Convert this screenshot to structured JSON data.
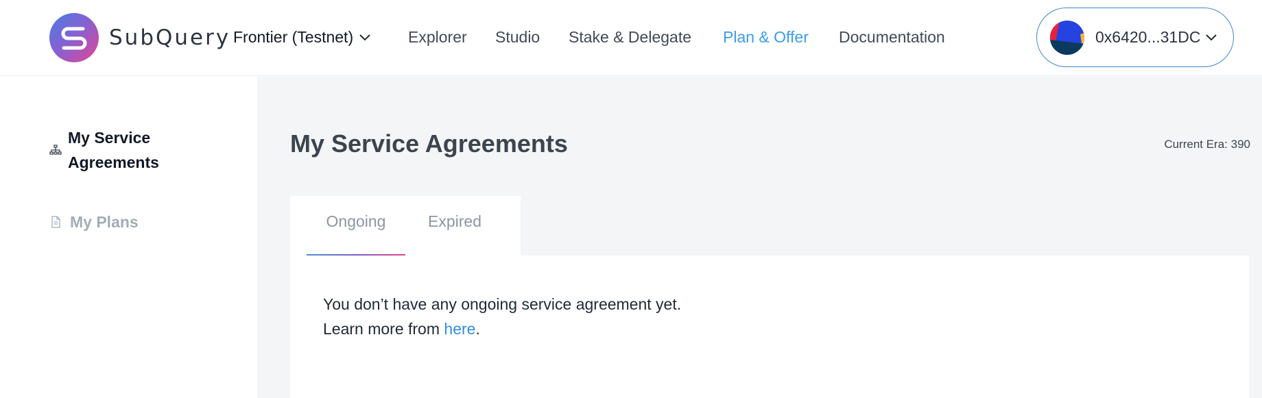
{
  "header": {
    "brand": "SubQuery",
    "network": "Frontier (Testnet)",
    "nav": {
      "explorer": "Explorer",
      "studio": "Studio",
      "stake": "Stake & Delegate",
      "plan": "Plan & Offer",
      "docs": "Documentation"
    },
    "wallet": {
      "address": "0x6420...31DC"
    }
  },
  "sidebar": {
    "items": [
      {
        "label": "My Service Agreements",
        "icon": "sitemap-icon",
        "active": true
      },
      {
        "label": "My Plans",
        "icon": "document-icon",
        "active": false
      }
    ]
  },
  "main": {
    "title": "My Service Agreements",
    "era_label": "Current Era: 390",
    "tabs": [
      {
        "label": "Ongoing",
        "active": true
      },
      {
        "label": "Expired",
        "active": false
      }
    ],
    "empty": {
      "line1": "You don’t have any ongoing service agreement yet.",
      "line2_prefix": "Learn more from ",
      "link": "here",
      "line2_suffix": "."
    }
  },
  "colors": {
    "accent": "#3a9cf1",
    "main_bg": "#f4f5f7",
    "title": "#3c444f",
    "muted": "#a3acb6"
  }
}
